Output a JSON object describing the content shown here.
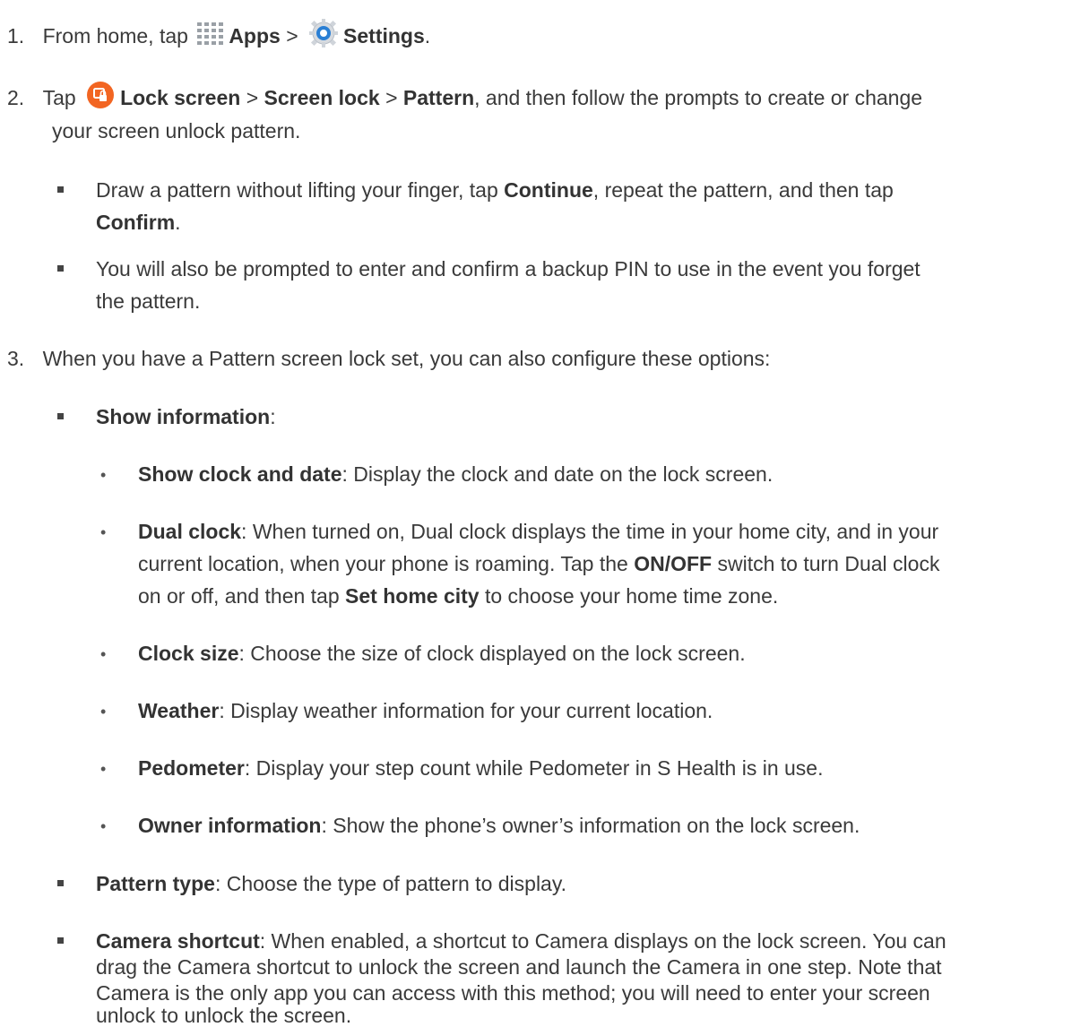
{
  "steps": [
    {
      "number": "1.",
      "parts": [
        "From home, tap",
        "Apps",
        ">",
        "Settings",
        "."
      ],
      "icons": [
        "apps-grid-icon",
        "settings-gear-icon"
      ]
    },
    {
      "number": "2.",
      "line1": [
        "Tap",
        "Lock screen",
        ">",
        "Screen lock",
        ">",
        "Pattern",
        ", and then follow the prompts to create or change"
      ],
      "line2": "your screen unlock pattern.",
      "icon": "lock-screen-icon",
      "bullets": [
        {
          "line1": [
            "Draw a pattern without lifting your finger, tap ",
            "Continue",
            ", repeat the pattern, and then tap"
          ],
          "line2": [
            "Confirm",
            "."
          ]
        },
        {
          "line1": "You will also be prompted to enter and confirm a backup PIN to use in the event you forget",
          "line2": "the pattern."
        }
      ]
    },
    {
      "number": "3.",
      "text": "When you have a Pattern screen lock set, you can also configure these options:",
      "options": [
        {
          "label": "Show information",
          "suffix": ":",
          "sub": [
            {
              "label": "Show clock and date",
              "text": ": Display the clock and date on the lock screen."
            },
            {
              "label": "Dual clock",
              "line1": ": When turned on, Dual clock displays the time in your home city, and in your",
              "line2a": "current location, when your phone is roaming. Tap the ",
              "line2b": "ON/OFF",
              "line2c": " switch to turn Dual clock",
              "line3a": "on or off, and then tap ",
              "line3b": "Set home city",
              "line3c": " to choose your home time zone."
            },
            {
              "label": "Clock size",
              "text": ": Choose the size of clock displayed on the lock screen."
            },
            {
              "label": "Weather",
              "text": ": Display weather information for your current location."
            },
            {
              "label": "Pedometer",
              "text": ": Display your step count while Pedometer in S Health is in use."
            },
            {
              "label": "Owner information",
              "text": ": Show the phone’s owner’s information on the lock screen."
            }
          ]
        },
        {
          "label": "Pattern type",
          "text": ": Choose the type of pattern to display."
        },
        {
          "label": "Camera shortcut",
          "line1": ": When enabled, a shortcut to Camera displays on the lock screen. You can",
          "line2": "drag the Camera shortcut to unlock the screen and launch the Camera in one step. Note that",
          "line3": "Camera is the only app you can access with this method; you will need to enter your screen",
          "line4": "unlock to unlock the screen."
        }
      ]
    }
  ],
  "bullet_char": "•"
}
